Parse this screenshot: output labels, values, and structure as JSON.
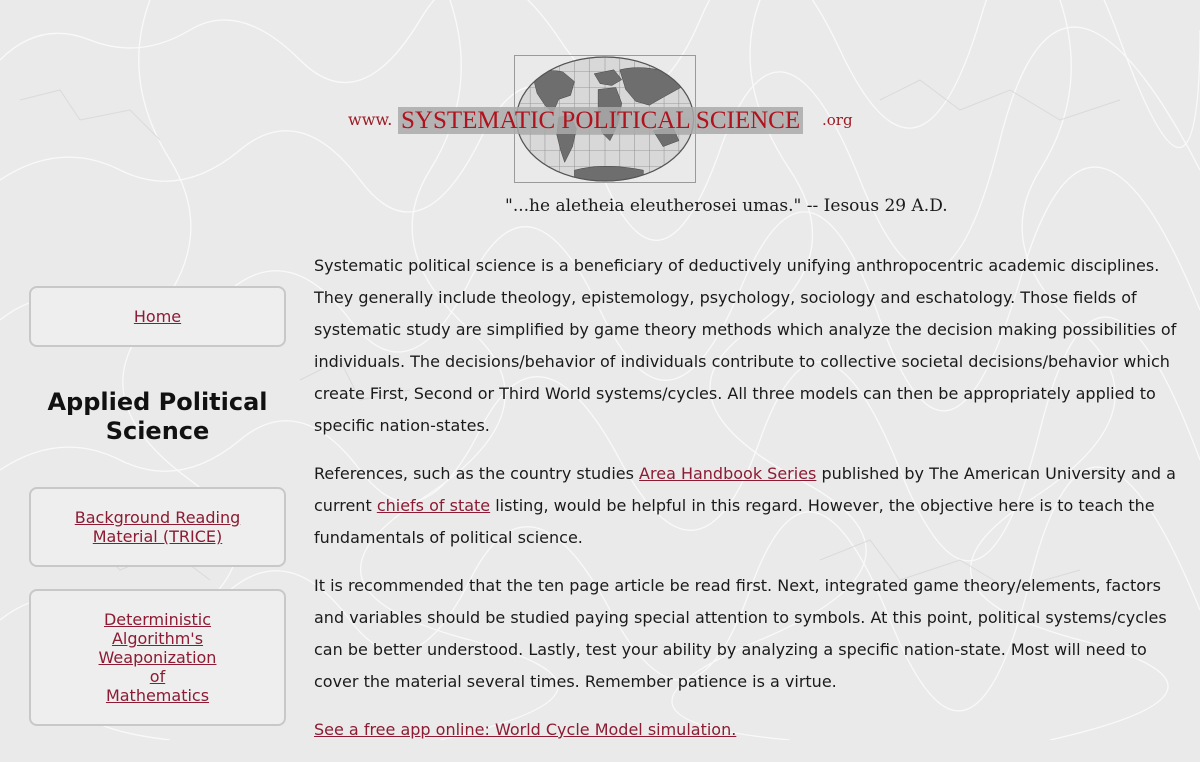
{
  "header": {
    "logo_prefix": "www.",
    "logo_title": "SYSTEMATIC POLITICAL SCIENCE",
    "logo_suffix": ".org",
    "quote": "\"...he aletheia eleutherosei umas.\" -- Iesous 29 A.D."
  },
  "sidebar": {
    "home_link": "Home",
    "section_title_line1": "Applied Political",
    "section_title_line2": "Science",
    "background_link_line1": "Background Reading",
    "background_link_line2": "Material (TRICE)",
    "algorithm_link_lines": [
      "Deterministic",
      "Algorithm's",
      "Weaponization",
      "of",
      "Mathematics"
    ]
  },
  "main": {
    "p1": "Systematic political science is a beneficiary of deductively unifying anthropocentric academic disciplines. They generally include theology, epistemology, psychology, sociology and eschatology. Those fields of systematic study are simplified by game theory methods which analyze the decision making possibilities of individuals. The decisions/behavior of individuals contribute to collective societal decisions/behavior which create First, Second or Third World systems/cycles. All three models can then be appropriately applied to specific nation-states.",
    "p2_before_link1": "References, such as the country studies ",
    "p2_link1": "Area Handbook Series",
    "p2_between": " published by The American University and a current ",
    "p2_link2": "chiefs of state",
    "p2_after": " listing, would be helpful in this regard. However, the objective here is to teach the fundamentals of political science.",
    "p3": "It is recommended that the ten page article be read first. Next, integrated game theory/elements, factors and variables should be studied paying special attention to symbols. At this point, political systems/cycles can be better understood. Lastly, test your ability by analyzing a specific nation-state. Most will need to cover the material several times. Remember patience is a virtue.",
    "app_link": "See a free app online: World Cycle Model simulation."
  },
  "colors": {
    "background": "#eaeaea",
    "link": "#8c1b33",
    "logo_red": "#b0121e",
    "box_border": "#c8c8c8"
  },
  "icons": {
    "logo_globe": "world-map-globe-icon",
    "background": "marble-crack-pattern"
  }
}
